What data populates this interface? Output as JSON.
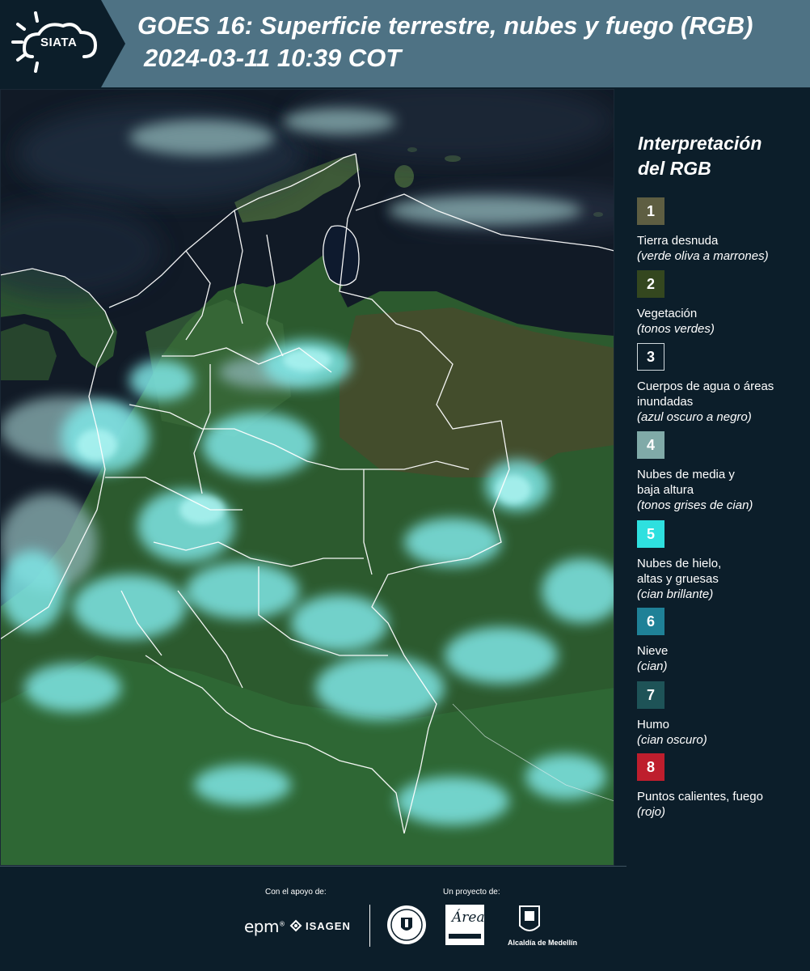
{
  "header": {
    "logo_text": "SIATA",
    "title_line1": "GOES 16: Superficie terrestre, nubes y fuego (RGB)",
    "title_line2": "2024-03-11 10:39 COT"
  },
  "legend": {
    "title_line1": "Interpretación",
    "title_line2": "del RGB",
    "items": [
      {
        "number": "1",
        "color": "#5e5e42",
        "label": "Tierra desnuda",
        "desc": "(verde oliva a marrones)"
      },
      {
        "number": "2",
        "color": "#34471f",
        "label": "Vegetación",
        "desc": "(tonos verdes)"
      },
      {
        "number": "3",
        "color": "#0c1e2a",
        "label": "Cuerpos de agua o áreas inundadas",
        "desc": "(azul oscuro a negro)"
      },
      {
        "number": "4",
        "color": "#80aaa8",
        "label": "Nubes de media y baja altura",
        "desc": "(tonos grises de cian)"
      },
      {
        "number": "5",
        "color": "#2ee0df",
        "label": "Nubes de hielo, altas y gruesas",
        "desc": "(cian brillante)"
      },
      {
        "number": "6",
        "color": "#1f8197",
        "label": "Nieve",
        "desc": "(cian)"
      },
      {
        "number": "7",
        "color": "#1e5357",
        "label": "Humo",
        "desc": "(cian oscuro)"
      },
      {
        "number": "8",
        "color": "#be1e2d",
        "label": "Puntos calientes, fuego",
        "desc": "(rojo)"
      }
    ]
  },
  "footer": {
    "support_label": "Con el apoyo de:",
    "project_label": "Un proyecto de:",
    "epm": "epm",
    "isagen": "ISAGEN",
    "area_logo_text": "Área",
    "alcaldia": "Alcaldía de Medellín"
  }
}
